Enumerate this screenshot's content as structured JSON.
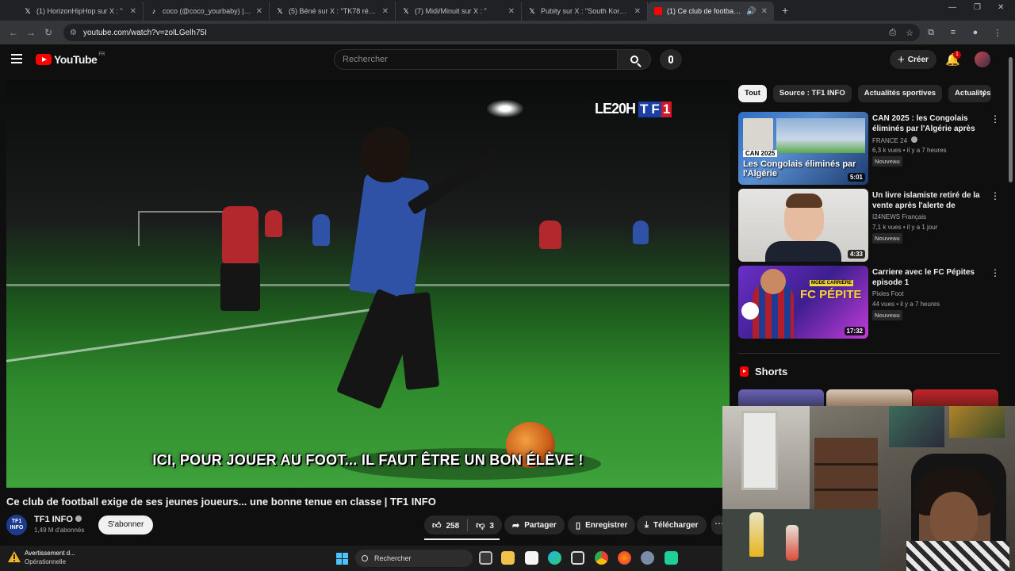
{
  "browser": {
    "tabs": [
      {
        "title": "(1) HorizonHipHop sur X : \"",
        "icon": "x-icon",
        "active": false
      },
      {
        "title": "coco (@coco_yourbaby) | TikTo",
        "icon": "tiktok-icon",
        "active": false
      },
      {
        "title": "(5) Béné sur X : \"TK78 réagit à l",
        "icon": "x-icon",
        "active": false
      },
      {
        "title": "(7) Midi/Minuit sur X : \"",
        "icon": "x-icon",
        "active": false
      },
      {
        "title": "Pubity sur X : \"South Korea's p",
        "icon": "x-icon",
        "active": false
      },
      {
        "title": "(1) Ce club de football exig",
        "icon": "youtube-icon",
        "active": true
      }
    ],
    "url": "youtube.com/watch?v=zolLGelh75I"
  },
  "youtube": {
    "logo_text": "YouTube",
    "country": "FR",
    "search_placeholder": "Rechercher",
    "create_label": "Créer",
    "notification_count": "1"
  },
  "player": {
    "bug_prefix": "LE20H",
    "bug_logo": [
      "T",
      "F",
      "1"
    ],
    "subtitle": "ICI, POUR JOUER AU FOOT... IL FAUT ÊTRE UN BON ÉLÈVE !"
  },
  "video": {
    "title": "Ce club de football exige de ses jeunes joueurs... une bonne tenue en classe | TF1 INFO",
    "channel_avatar_text": "TF1 INFO",
    "channel": "TF1 INFO",
    "subscribers": "1,49 M d'abonnés",
    "subscribe_label": "S'abonner",
    "likes": "258",
    "dislikes": "3",
    "share_label": "Partager",
    "save_label": "Enregistrer",
    "download_label": "Télécharger"
  },
  "sidebar": {
    "chips": [
      "Tout",
      "Source : TF1 INFO",
      "Actualités sportives",
      "Actualités"
    ],
    "recommendations": [
      {
        "title": "CAN 2025 : les Congolais éliminés par l'Algérie après un ...",
        "channel": "FRANCE 24",
        "meta": "6,3 k vues • il y a 7 heures",
        "badge": "Nouveau",
        "duration": "5:01",
        "thumb_tag": "CAN 2025",
        "thumb_caption": "Les Congolais éliminés par l'Algérie"
      },
      {
        "title": "Un livre islamiste retiré de la vente après l'alerte de Yohan ...",
        "channel": "I24NEWS Français",
        "meta": "7,1 k vues • il y a 1 jour",
        "badge": "Nouveau",
        "duration": "4:33"
      },
      {
        "title": "Carriere avec le FC Pépites episode 1",
        "channel": "Pixies Foot",
        "meta": "44 vues • il y a 7 heures",
        "badge": "Nouveau",
        "duration": "17:32",
        "thumb_tag": "MODE CARRIÈRE",
        "thumb_caption": "FC PÉPITE"
      }
    ],
    "shorts_label": "Shorts"
  },
  "taskbar": {
    "warning_title": "Avertissement d...",
    "warning_status": "Opérationnelle",
    "search_placeholder": "Rechercher"
  }
}
